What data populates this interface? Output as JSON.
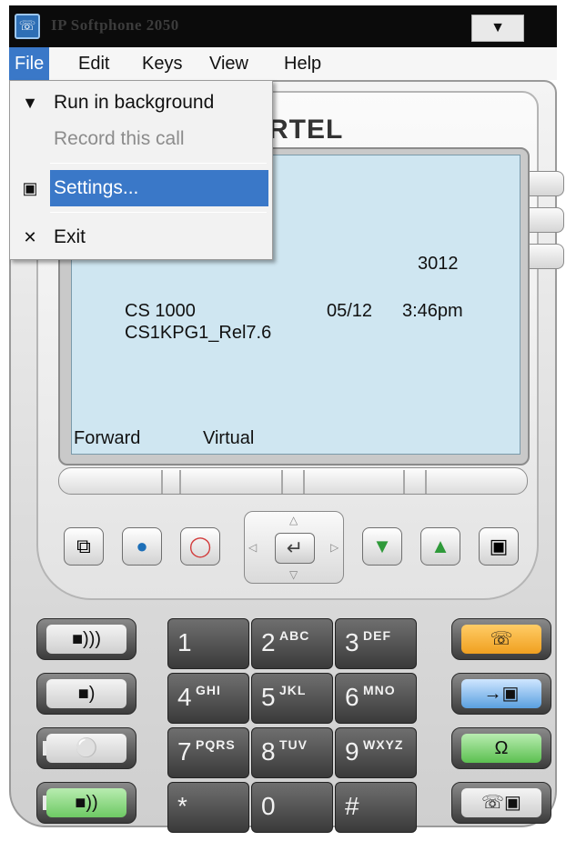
{
  "window": {
    "title": "IP Softphone 2050",
    "app_icon": "softphone-icon",
    "title_button_glyph": "▼"
  },
  "menubar": {
    "items": [
      {
        "label": "File",
        "active": true
      },
      {
        "label": "Edit"
      },
      {
        "label": "Keys"
      },
      {
        "label": "View"
      },
      {
        "label": "Help"
      }
    ]
  },
  "file_menu": {
    "items": [
      {
        "label": "Run in background",
        "icon": "minimize-icon",
        "enabled": true
      },
      {
        "label": "Record this call",
        "enabled": false
      },
      {
        "label": "Settings...",
        "icon": "settings-icon",
        "enabled": true,
        "highlighted": true
      },
      {
        "label": "Exit",
        "icon": "close-icon",
        "enabled": true
      }
    ]
  },
  "phone": {
    "brand": "NORTEL",
    "brand_visible": "RTEL",
    "accent_colors": {
      "lcd": "#cfe6f1",
      "release": "#f0a020",
      "transfer": "#5aa0e0",
      "headset": "#5cc050"
    },
    "lcd": {
      "extension": "3012",
      "system": "CS 1000",
      "date": "05/12",
      "time": "3:46pm",
      "release": "CS1KPG1_Rel7.6",
      "softkey1": "Forward",
      "softkey2": "Virtual"
    },
    "nav_buttons": [
      {
        "name": "copy-button",
        "icon": "copy-icon"
      },
      {
        "name": "globe-button",
        "icon": "globe-icon"
      },
      {
        "name": "stop-button",
        "icon": "stop-icon"
      },
      {
        "name": "inbox-button",
        "icon": "inbox-icon"
      },
      {
        "name": "outbox-button",
        "icon": "outbox-icon"
      },
      {
        "name": "directory-button",
        "icon": "book-icon"
      }
    ],
    "dialpad": [
      {
        "n": "1",
        "l": ""
      },
      {
        "n": "2",
        "l": "ABC"
      },
      {
        "n": "3",
        "l": "DEF"
      },
      {
        "n": "4",
        "l": "GHI"
      },
      {
        "n": "5",
        "l": "JKL"
      },
      {
        "n": "6",
        "l": "MNO"
      },
      {
        "n": "7",
        "l": "PQRS"
      },
      {
        "n": "8",
        "l": "TUV"
      },
      {
        "n": "9",
        "l": "WXYZ"
      },
      {
        "n": "*",
        "l": ""
      },
      {
        "n": "0",
        "l": ""
      },
      {
        "n": "#",
        "l": ""
      }
    ]
  }
}
